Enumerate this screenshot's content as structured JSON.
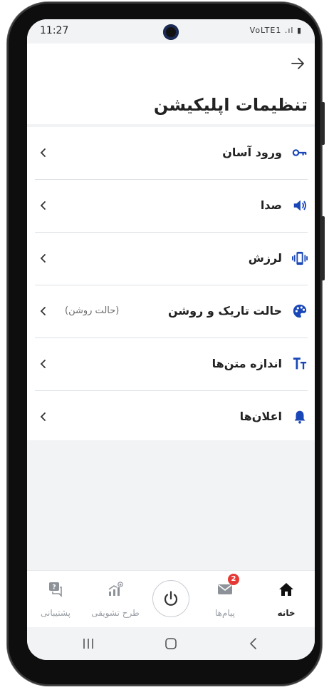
{
  "status_bar": {
    "time": "11:27",
    "icons": "VoLTE1 .ıl ▮"
  },
  "header": {
    "title": "تنظیمات اپلیکیشن"
  },
  "settings": [
    {
      "label": "ورود آسان",
      "icon": "key-icon",
      "value": ""
    },
    {
      "label": "صدا",
      "icon": "speaker-icon",
      "value": ""
    },
    {
      "label": "لرزش",
      "icon": "vibration-icon",
      "value": ""
    },
    {
      "label": "حالت تاریک و روشن",
      "icon": "palette-icon",
      "value": "(حالت روشن)"
    },
    {
      "label": "اندازه متن‌ها",
      "icon": "text-size-icon",
      "value": ""
    },
    {
      "label": "اعلان‌ها",
      "icon": "bell-icon",
      "value": ""
    }
  ],
  "bottom_nav": {
    "home": "خانه",
    "messages": "پیام‌ها",
    "messages_badge": "2",
    "rewards": "طرح تشویقی",
    "support": "پشتیبانی"
  },
  "colors": {
    "accent": "#1a47b8",
    "badge": "#e53935",
    "text": "#222222",
    "muted": "#9a9ea5"
  }
}
